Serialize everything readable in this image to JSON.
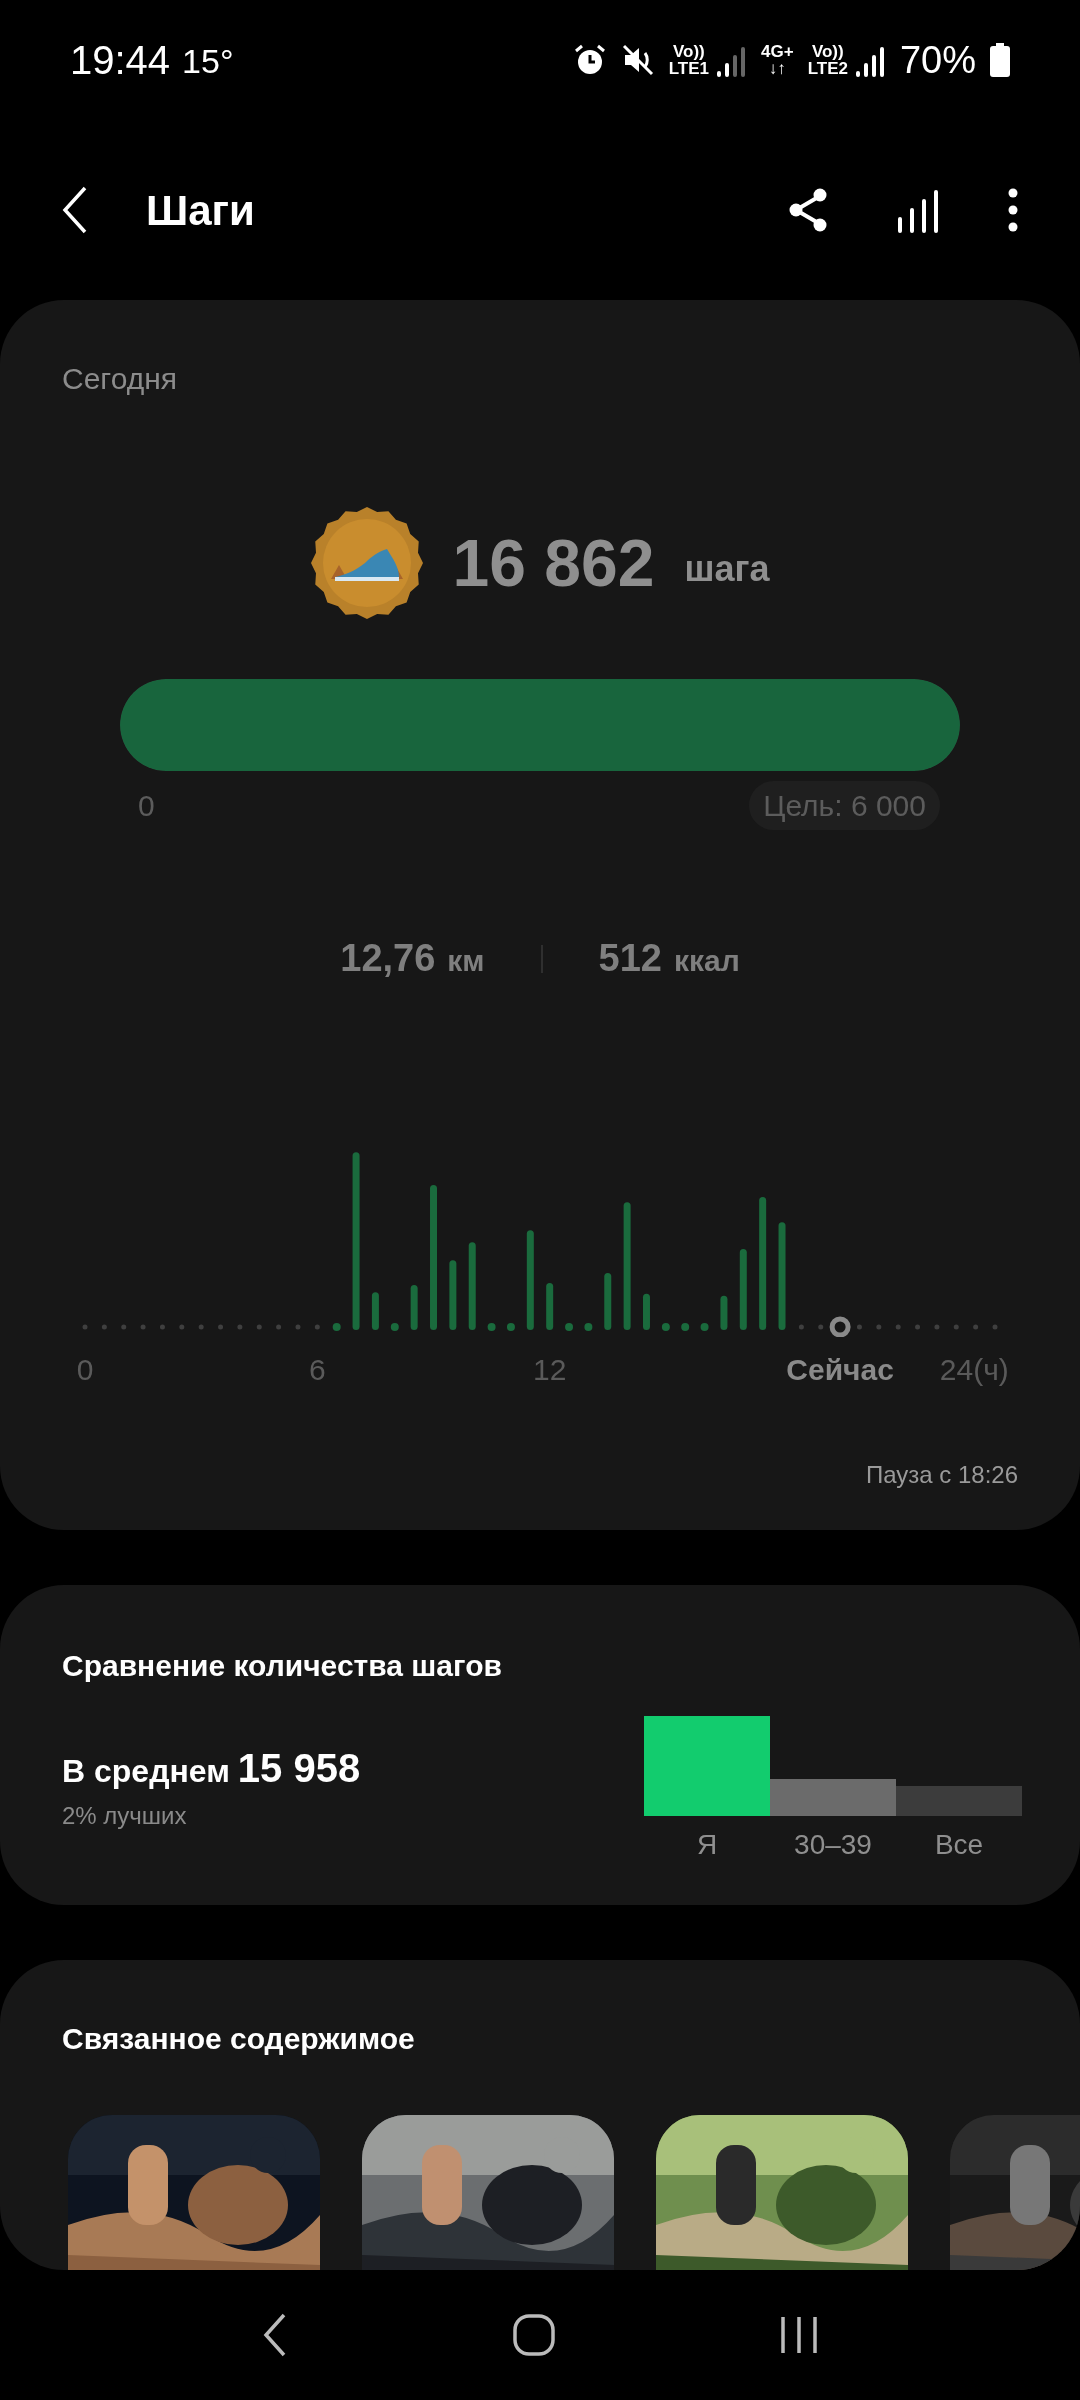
{
  "status_bar": {
    "time": "19:44",
    "temperature": "15°",
    "networks": [
      {
        "top": "Vo))",
        "bottom": "LTE1",
        "kind": "signal-weak"
      },
      {
        "top": "4G+",
        "bottom": "↓↑",
        "kind": "none"
      },
      {
        "top": "Vo))",
        "bottom": "LTE2",
        "kind": "signal"
      }
    ],
    "battery": "70%"
  },
  "header": {
    "title": "Шаги"
  },
  "today_card": {
    "label": "Сегодня",
    "steps": "16 862",
    "steps_unit": "шага",
    "progress": {
      "level": 1,
      "start": "0",
      "goal": "Цель: 6 000"
    },
    "stats": [
      {
        "value": "12,76",
        "unit": "км"
      },
      {
        "value": "512",
        "unit": "ккал"
      }
    ],
    "axis_labels": [
      {
        "text": "0",
        "kind": "tick"
      },
      {
        "text": "6",
        "kind": "tick"
      },
      {
        "text": "12",
        "kind": "tick"
      },
      {
        "text": "Сейчас",
        "kind": "now"
      },
      {
        "text": "24(ч)",
        "kind": "end"
      }
    ],
    "pause": "Пауза с 18:26"
  },
  "comparison": {
    "title": "Сравнение количества шагов",
    "average_label": "В среднем",
    "average_value": "15 958",
    "rank": "2% лучших",
    "bars": [
      {
        "label": "Я",
        "color": "#12cc6e"
      },
      {
        "label": "30–39",
        "color": "#6b6b6b"
      },
      {
        "label": "Все",
        "color": "#3c3c3c"
      }
    ]
  },
  "related": {
    "title": "Связанное содержимое"
  }
}
